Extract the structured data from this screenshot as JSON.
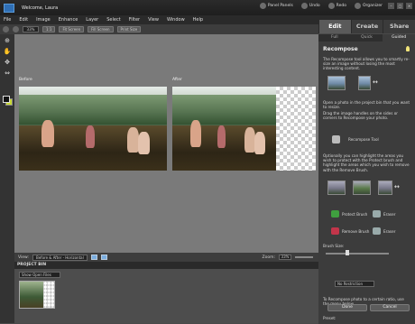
{
  "window": {
    "title": "Welcome, Laura",
    "actions": [
      "Panel Panels",
      "Undo",
      "Redo",
      "Organizer"
    ]
  },
  "menu": [
    "File",
    "Edit",
    "Image",
    "Enhance",
    "Layer",
    "Select",
    "Filter",
    "View",
    "Window",
    "Help"
  ],
  "workspace_tabs": [
    "Edit",
    "Create",
    "Share"
  ],
  "options_bar": {
    "zoom": "33%",
    "buttons": [
      "1:1",
      "Fit Screen",
      "Fill Screen",
      "Print Size"
    ]
  },
  "canvas": {
    "before_label": "Before",
    "after_label": "After"
  },
  "view_bar": {
    "view_label": "View:",
    "view_value": "Before & After - Horizontal",
    "zoom_label": "Zoom:",
    "zoom_value": "33%"
  },
  "project_bin": {
    "title": "PROJECT BIN",
    "filter": "Show Open Files"
  },
  "panel": {
    "subtabs": [
      "Full",
      "Quick",
      "Guided"
    ],
    "heading": "Recompose",
    "intro": "The Recompose tool allows you to smartly re-size an image without losing the most interesting content.",
    "step1": "Open a photo in the project bin that you want to resize.",
    "step2": "Drag the image handles on the sides or corners to Recompose your photo.",
    "tool_label": "Recompose Tool",
    "step3": "Optionally you can highlight the areas you wish to protect with the Protect brush and highlight the areas which you wish to remove with the Remove Brush.",
    "brushes": [
      {
        "label": "Protect Brush",
        "color": "#3f9f3f"
      },
      {
        "label": "Eraser",
        "color": "#9aa"
      },
      {
        "label": "Remove Brush",
        "color": "#c2354a"
      },
      {
        "label": "Eraser",
        "color": "#9aa"
      }
    ],
    "brush_size_label": "Brush Size:",
    "ratio_text": "To Recompose photo to a certain ratio, use the menu below.",
    "preset_label": "Preset:",
    "preset_value": "No Restriction",
    "done_label": "Done",
    "cancel_label": "Cancel"
  }
}
